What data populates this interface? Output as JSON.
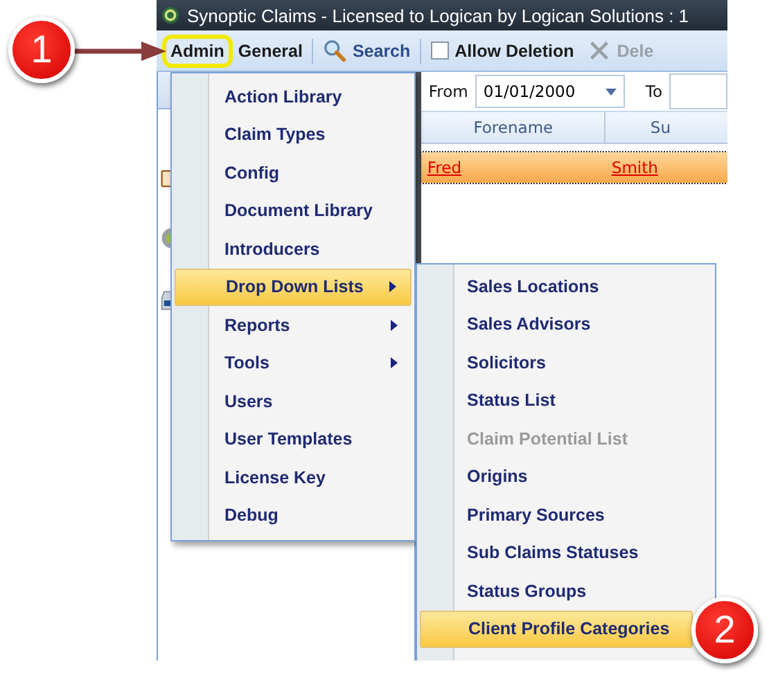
{
  "window": {
    "title": "Synoptic Claims - Licensed to Logican by Logican Solutions : 1"
  },
  "toolbar": {
    "items": [
      {
        "kind": "menu",
        "label": "Admin",
        "selected": true
      },
      {
        "kind": "menu",
        "label": "General",
        "selected": false
      },
      {
        "kind": "search",
        "label": "Search"
      },
      {
        "kind": "checkbox",
        "label": "Allow Deletion",
        "checked": false
      },
      {
        "kind": "delete",
        "label": "Dele",
        "disabled": true
      }
    ]
  },
  "filter": {
    "from_label": "From",
    "from_value": "01/01/2000",
    "to_label": "To"
  },
  "grid": {
    "columns": [
      "Forename",
      "Su"
    ],
    "rows": [
      {
        "cells": [
          "Fred",
          "Smith"
        ],
        "selected": true
      }
    ]
  },
  "admin_menu": {
    "items": [
      {
        "label": "Action Library",
        "has_submenu": false,
        "selected": false
      },
      {
        "label": "Claim Types",
        "has_submenu": false,
        "selected": false
      },
      {
        "label": "Config",
        "has_submenu": false,
        "selected": false
      },
      {
        "label": "Document Library",
        "has_submenu": false,
        "selected": false
      },
      {
        "label": "Introducers",
        "has_submenu": false,
        "selected": false
      },
      {
        "label": "Drop Down Lists",
        "has_submenu": true,
        "selected": true
      },
      {
        "label": "Reports",
        "has_submenu": true,
        "selected": false
      },
      {
        "label": "Tools",
        "has_submenu": true,
        "selected": false
      },
      {
        "label": "Users",
        "has_submenu": false,
        "selected": false
      },
      {
        "label": "User Templates",
        "has_submenu": false,
        "selected": false
      },
      {
        "label": "License Key",
        "has_submenu": false,
        "selected": false
      },
      {
        "label": "Debug",
        "has_submenu": false,
        "selected": false
      }
    ]
  },
  "submenu": {
    "items": [
      {
        "label": "Sales Locations",
        "disabled": false,
        "selected": false
      },
      {
        "label": "Sales Advisors",
        "disabled": false,
        "selected": false
      },
      {
        "label": "Solicitors",
        "disabled": false,
        "selected": false
      },
      {
        "label": "Status List",
        "disabled": false,
        "selected": false
      },
      {
        "label": "Claim Potential List",
        "disabled": true,
        "selected": false
      },
      {
        "label": "Origins",
        "disabled": false,
        "selected": false
      },
      {
        "label": "Primary Sources",
        "disabled": false,
        "selected": false
      },
      {
        "label": "Sub Claims Statuses",
        "disabled": false,
        "selected": false
      },
      {
        "label": "Status Groups",
        "disabled": false,
        "selected": false
      },
      {
        "label": "Client Profile Categories",
        "disabled": false,
        "selected": true
      }
    ]
  },
  "callouts": [
    "1",
    "2"
  ]
}
